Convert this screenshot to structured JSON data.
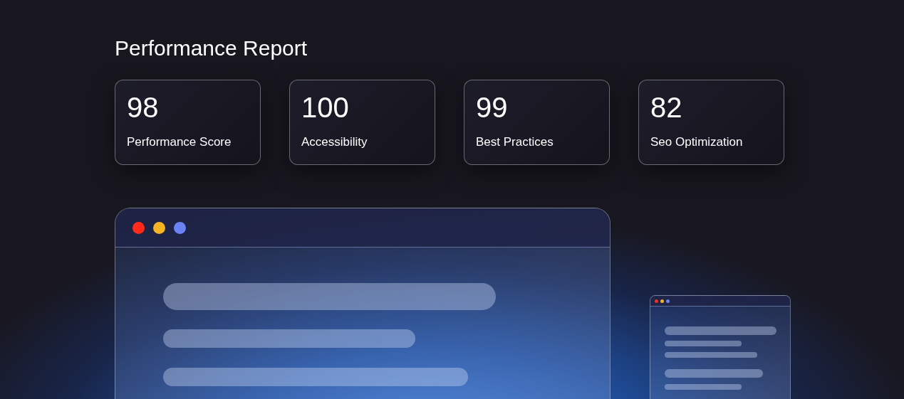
{
  "title": "Performance Report",
  "metrics": [
    {
      "value": "98",
      "label": "Performance Score"
    },
    {
      "value": "100",
      "label": "Accessibility"
    },
    {
      "value": "99",
      "label": "Best Practices"
    },
    {
      "value": "82",
      "label": "Seo Optimization"
    }
  ],
  "window_dots": [
    {
      "color": "#ff2a1a"
    },
    {
      "color": "#f6b323"
    },
    {
      "color": "#6b82f5"
    }
  ]
}
